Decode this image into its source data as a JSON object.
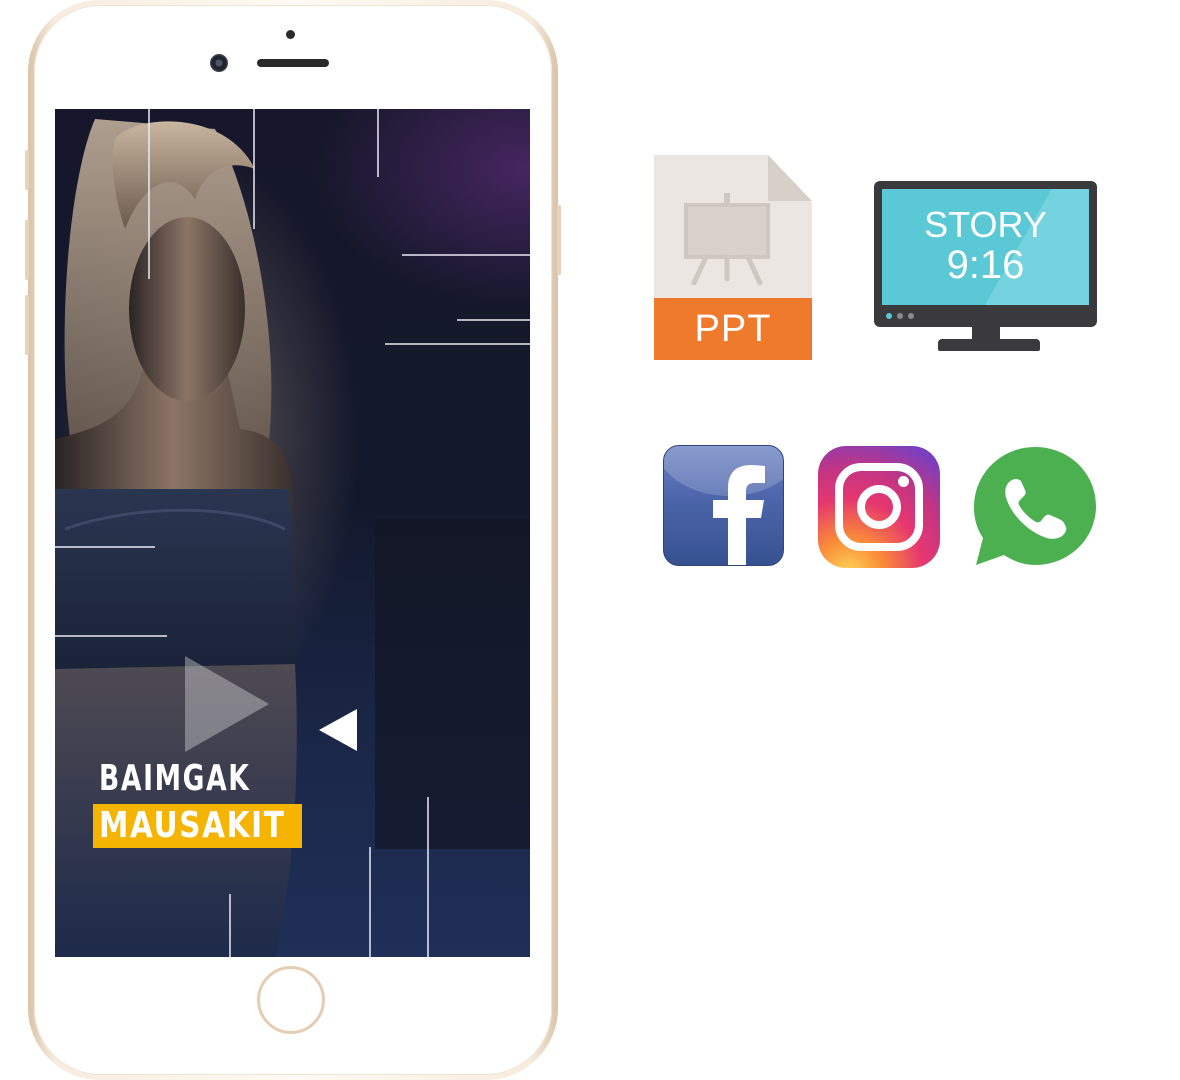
{
  "phone": {
    "screen": {
      "title_line1": "BAIMGAK",
      "title_line2": "MAUSAKIT",
      "title_highlight_color": "#f4b400"
    }
  },
  "formats": {
    "file_icon": {
      "label": "PPT",
      "band_color": "#f07a2b"
    },
    "monitor": {
      "line1": "STORY",
      "line2": "9:16",
      "screen_color": "#5bc8d6"
    }
  },
  "social": {
    "icons": [
      "facebook-icon",
      "instagram-icon",
      "whatsapp-icon"
    ],
    "colors": {
      "facebook": "#3b5998",
      "whatsapp": "#4caf50"
    }
  }
}
